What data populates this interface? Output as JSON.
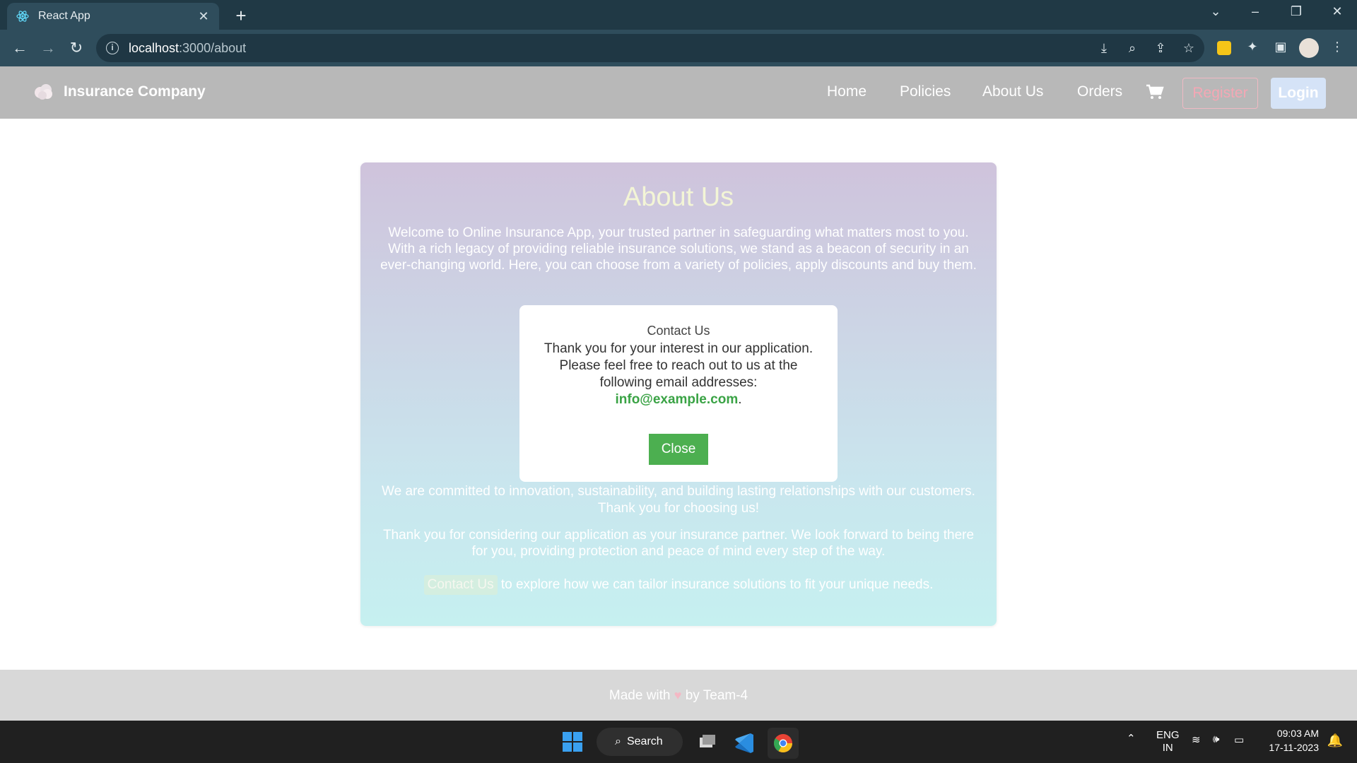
{
  "browser": {
    "tab_title": "React App",
    "tab_close": "✕",
    "new_tab": "+",
    "url_host": "localhost",
    "url_path": ":3000/about"
  },
  "navbar": {
    "brand": "Insurance Company",
    "links": [
      "Home",
      "Policies",
      "About Us",
      "Orders"
    ],
    "register": "Register",
    "login": "Login"
  },
  "about": {
    "title": "About Us",
    "p1": "Welcome to Online Insurance App, your trusted partner in safeguarding what matters most to you. With a rich legacy of providing reliable insurance solutions, we stand as a beacon of security in an ever-changing world. Here, you can choose from a variety of policies, apply discounts and buy them.",
    "p2": "We are committed to innovation, sustainability, and building lasting relationships with our customers. Thank you for choosing us!",
    "p3": "Thank you for considering our application as your insurance partner. We look forward to being there for you, providing protection and peace of mind every step of the way.",
    "contact_link": "Contact Us",
    "p4_rest": " to explore how we can tailor insurance solutions to fit your unique needs."
  },
  "modal": {
    "title": "Contact Us",
    "body": "Thank you for your interest in our application. Please feel free to reach out to us at the following email addresses:",
    "email": "info@example.com",
    "period": ".",
    "close": "Close"
  },
  "footer": {
    "made_with": "Made with",
    "heart": "♥",
    "by": "by Team-4"
  },
  "taskbar": {
    "search": "Search",
    "lang_line1": "ENG",
    "lang_line2": "IN",
    "time": "09:03 AM",
    "date": "17-11-2023"
  },
  "colors": {
    "navbar_bg": "#b8b8b8",
    "card_gradient_top": "#cfc3dc",
    "card_gradient_bottom": "#c6f0f0",
    "close_button": "#4caf50",
    "email": "#3aa345",
    "register": "#f4a7b4",
    "login_bg": "#d5e3f7"
  }
}
